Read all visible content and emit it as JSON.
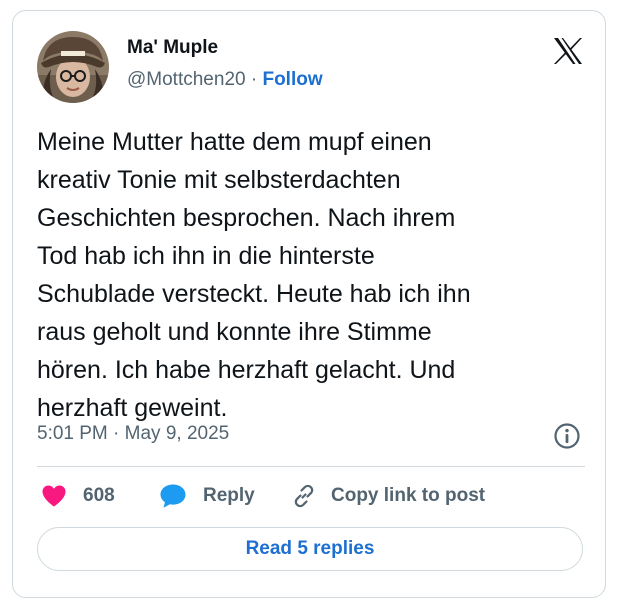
{
  "author": {
    "name": "Ma' Muple",
    "handle": "@Mottchen20",
    "separator": " · ",
    "follow_label": "Follow"
  },
  "tweet": {
    "text": "Meine Mutter hatte dem mupf einen\nkreativ Tonie mit selbsterdachten\nGeschichten besprochen. Nach ihrem\nTod hab ich ihn in die hinterste\nSchublade versteckt. Heute hab ich ihn\nraus geholt und konnte ihre Stimme\nhören. Ich habe herzhaft gelacht. Und\nherzhaft geweint.",
    "timestamp": "5:01 PM · May 9, 2025"
  },
  "actions": {
    "like_count": "608",
    "reply_label": "Reply",
    "copy_link_label": "Copy link to post"
  },
  "read_replies_label": "Read 5 replies",
  "icons": {
    "logo": "x-logo-icon",
    "info": "info-icon",
    "like": "heart-icon",
    "reply": "speech-bubble-icon",
    "copy": "link-icon"
  },
  "colors": {
    "like": "#f91880",
    "reply": "#1d9bf0",
    "link": "#1d6fd1",
    "muted": "#536471",
    "border": "#cfd9de"
  }
}
